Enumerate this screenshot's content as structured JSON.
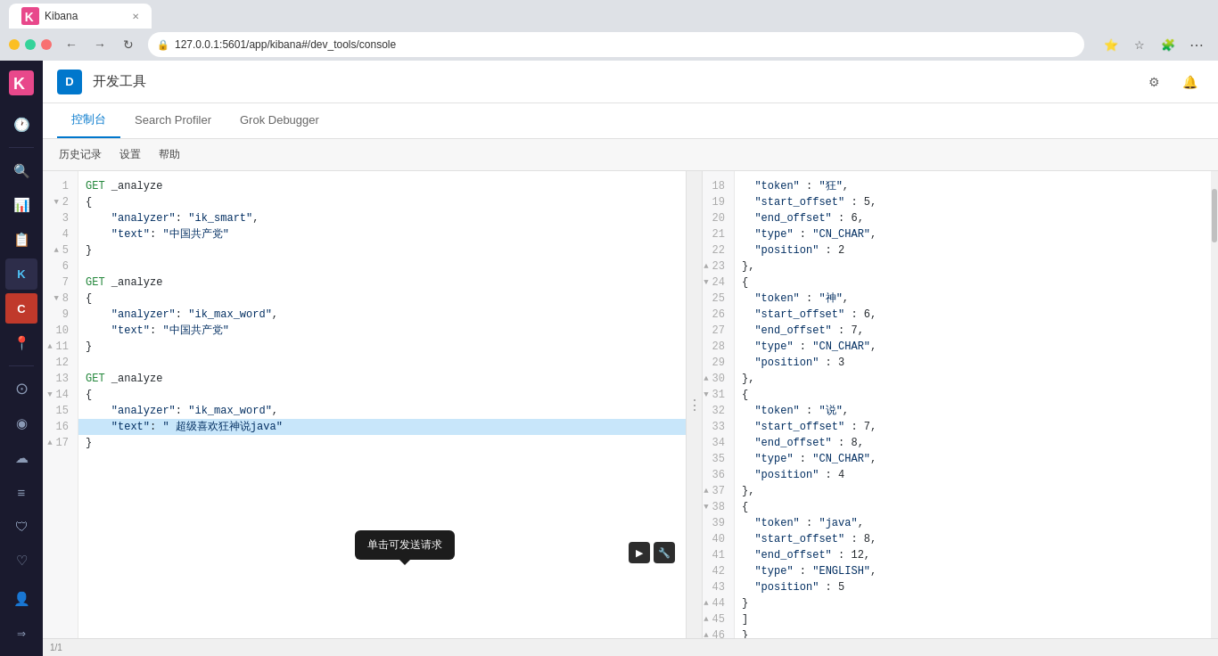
{
  "browser": {
    "url": "127.0.0.1:5601/app/kibana#/dev_tools/console",
    "tab_title": "Kibana",
    "window_title": "Kibana"
  },
  "app": {
    "logo_letter": "D",
    "title": "开发工具"
  },
  "tabs": [
    {
      "id": "console",
      "label": "控制台",
      "active": true
    },
    {
      "id": "search-profiler",
      "label": "Search Profiler",
      "active": false
    },
    {
      "id": "grok-debugger",
      "label": "Grok Debugger",
      "active": false
    }
  ],
  "toolbar": {
    "history": "历史记录",
    "settings": "设置",
    "help": "帮助"
  },
  "editor": {
    "lines": [
      {
        "num": "1",
        "content": "GET _analyze",
        "indent": 0,
        "type": "method"
      },
      {
        "num": "2",
        "content": "{",
        "indent": 0,
        "type": "brace",
        "foldable": true
      },
      {
        "num": "3",
        "content": "  \"analyzer\": \"ik_smart\",",
        "indent": 1,
        "type": "prop"
      },
      {
        "num": "4",
        "content": "  \"text\": \"中国共产党\"",
        "indent": 1,
        "type": "prop"
      },
      {
        "num": "5",
        "content": "}",
        "indent": 0,
        "type": "brace",
        "foldable": true
      },
      {
        "num": "6",
        "content": "",
        "indent": 0,
        "type": "empty"
      },
      {
        "num": "7",
        "content": "GET _analyze",
        "indent": 0,
        "type": "method"
      },
      {
        "num": "8",
        "content": "{",
        "indent": 0,
        "type": "brace",
        "foldable": true
      },
      {
        "num": "9",
        "content": "  \"analyzer\": \"ik_max_word\",",
        "indent": 1,
        "type": "prop"
      },
      {
        "num": "10",
        "content": "  \"text\": \"中国共产党\"",
        "indent": 1,
        "type": "prop"
      },
      {
        "num": "11",
        "content": "}",
        "indent": 0,
        "type": "brace",
        "foldable": true
      },
      {
        "num": "12",
        "content": "",
        "indent": 0,
        "type": "empty"
      },
      {
        "num": "13",
        "content": "GET _analyze",
        "indent": 0,
        "type": "method"
      },
      {
        "num": "14",
        "content": "{",
        "indent": 0,
        "type": "brace",
        "foldable": true
      },
      {
        "num": "15",
        "content": "  \"analyzer\": \"ik_max_word\",",
        "indent": 1,
        "type": "prop"
      },
      {
        "num": "16",
        "content": "  \"text\": \" 超级喜欢狂神说java\"",
        "indent": 1,
        "type": "prop",
        "selected": true
      },
      {
        "num": "17",
        "content": "}",
        "indent": 0,
        "type": "brace",
        "foldable": true
      }
    ]
  },
  "result": {
    "lines": [
      {
        "num": "18",
        "content": "  \"token\" : \"狂\","
      },
      {
        "num": "19",
        "content": "  \"start_offset\" : 5,"
      },
      {
        "num": "20",
        "content": "  \"end_offset\" : 6,"
      },
      {
        "num": "21",
        "content": "  \"type\" : \"CN_CHAR\","
      },
      {
        "num": "22",
        "content": "  \"position\" : 2"
      },
      {
        "num": "23",
        "content": "},"
      },
      {
        "num": "24",
        "content": "{",
        "foldable": true
      },
      {
        "num": "25",
        "content": "  \"token\" : \"神\","
      },
      {
        "num": "26",
        "content": "  \"start_offset\" : 6,"
      },
      {
        "num": "27",
        "content": "  \"end_offset\" : 7,"
      },
      {
        "num": "28",
        "content": "  \"type\" : \"CN_CHAR\","
      },
      {
        "num": "29",
        "content": "  \"position\" : 3"
      },
      {
        "num": "30",
        "content": "},"
      },
      {
        "num": "31",
        "content": "{",
        "foldable": true
      },
      {
        "num": "32",
        "content": "  \"token\" : \"说\","
      },
      {
        "num": "33",
        "content": "  \"start_offset\" : 7,"
      },
      {
        "num": "34",
        "content": "  \"end_offset\" : 8,"
      },
      {
        "num": "35",
        "content": "  \"type\" : \"CN_CHAR\","
      },
      {
        "num": "36",
        "content": "  \"position\" : 4"
      },
      {
        "num": "37",
        "content": "},"
      },
      {
        "num": "38",
        "content": "{",
        "foldable": true
      },
      {
        "num": "39",
        "content": "  \"token\" : \"java\","
      },
      {
        "num": "40",
        "content": "  \"start_offset\" : 8,"
      },
      {
        "num": "41",
        "content": "  \"end_offset\" : 12,"
      },
      {
        "num": "42",
        "content": "  \"type\" : \"ENGLISH\","
      },
      {
        "num": "43",
        "content": "  \"position\" : 5"
      },
      {
        "num": "44",
        "content": "}"
      },
      {
        "num": "45",
        "content": "]"
      },
      {
        "num": "46",
        "content": "}"
      },
      {
        "num": "47",
        "content": ""
      }
    ]
  },
  "tooltip": {
    "text": "单击可发送请求"
  },
  "icons": {
    "run": "▶",
    "wrench": "🔧",
    "back": "←",
    "forward": "→",
    "refresh": "↻",
    "home": "⌂",
    "star": "☆",
    "menu": "⋯",
    "notification": "🔔",
    "account": "👤",
    "kibana_tab": "K",
    "lock": "🔒"
  },
  "status": {
    "line_col": "1/1"
  },
  "sidebar": {
    "items": [
      {
        "id": "clock",
        "icon": "🕐"
      },
      {
        "id": "discover",
        "icon": "🔍"
      },
      {
        "id": "visualize",
        "icon": "📊"
      },
      {
        "id": "dashboard",
        "icon": "📋"
      },
      {
        "id": "kibana-mark",
        "icon": "K"
      },
      {
        "id": "canvas",
        "icon": "C"
      },
      {
        "id": "maps",
        "icon": "📍"
      },
      {
        "id": "github",
        "icon": "⊙"
      },
      {
        "id": "apm",
        "icon": "◉"
      },
      {
        "id": "infra",
        "icon": "☁"
      },
      {
        "id": "logs",
        "icon": "≡"
      },
      {
        "id": "siem",
        "icon": "🛡"
      },
      {
        "id": "uptime",
        "icon": "♡"
      },
      {
        "id": "ml",
        "icon": "⇒"
      },
      {
        "id": "user",
        "icon": "👤"
      },
      {
        "id": "spaces",
        "icon": "❯"
      }
    ]
  }
}
